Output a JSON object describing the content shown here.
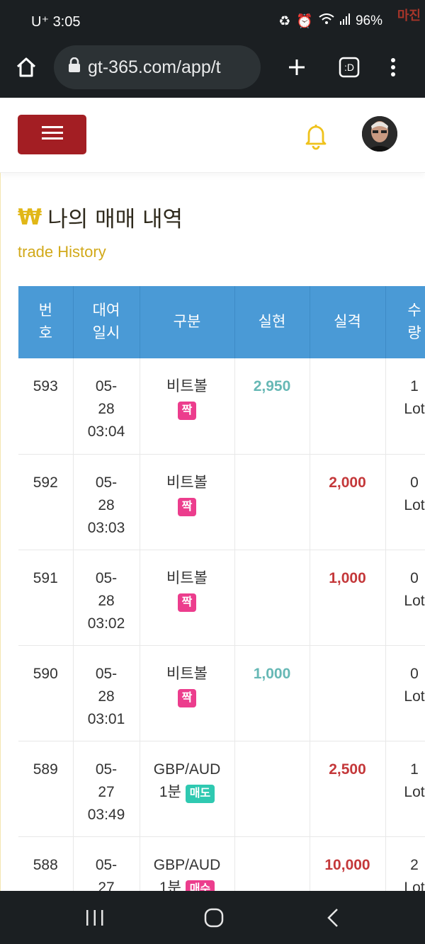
{
  "status": {
    "carrier": "U⁺",
    "time": "3:05",
    "battery": "96%",
    "watermark": "마진"
  },
  "browser": {
    "url": "gt-365.com/app/t",
    "tab_label": ":D"
  },
  "page": {
    "title_icon": "₩",
    "title": "나의 매매 내역",
    "subtitle": "trade History"
  },
  "table": {
    "headers": {
      "no": [
        "번",
        "호"
      ],
      "date": [
        "대여",
        "일시"
      ],
      "type": "구분",
      "real": "실현",
      "loss": "실격",
      "qty": [
        "수",
        "량"
      ]
    },
    "rows": [
      {
        "no": "593",
        "date_a": "05-",
        "date_b": "28",
        "time": "03:04",
        "game": "비트볼",
        "sub": "",
        "badge": "짝",
        "real": "2,950",
        "loss": "",
        "qty": "1",
        "unit": "Lot"
      },
      {
        "no": "592",
        "date_a": "05-",
        "date_b": "28",
        "time": "03:03",
        "game": "비트볼",
        "sub": "",
        "badge": "짝",
        "real": "",
        "loss": "2,000",
        "qty": "0",
        "unit": "Lot"
      },
      {
        "no": "591",
        "date_a": "05-",
        "date_b": "28",
        "time": "03:02",
        "game": "비트볼",
        "sub": "",
        "badge": "짝",
        "real": "",
        "loss": "1,000",
        "qty": "0",
        "unit": "Lot"
      },
      {
        "no": "590",
        "date_a": "05-",
        "date_b": "28",
        "time": "03:01",
        "game": "비트볼",
        "sub": "",
        "badge": "짝",
        "real": "1,000",
        "loss": "",
        "qty": "0",
        "unit": "Lot"
      },
      {
        "no": "589",
        "date_a": "05-",
        "date_b": "27",
        "time": "03:49",
        "game": "GBP/AUD",
        "sub": "1분",
        "badge": "매도",
        "real": "",
        "loss": "2,500",
        "qty": "1",
        "unit": "Lot"
      },
      {
        "no": "588",
        "date_a": "05-",
        "date_b": "27",
        "time": "",
        "game": "GBP/AUD",
        "sub": "1분",
        "badge": "매수",
        "real": "",
        "loss": "10,000",
        "qty": "2",
        "unit": "Lot"
      }
    ]
  },
  "colors": {
    "accent": "#a31e23",
    "gold": "#e1b717",
    "header_blue": "#4a9ad6",
    "profit": "#66b8b5",
    "loss": "#c4383a",
    "badge_pink": "#ec3d8d",
    "badge_teal": "#2fc9b1"
  },
  "icons": [
    "home-icon",
    "lock-icon",
    "plus-icon",
    "tabs-icon",
    "more-vert-icon",
    "menu-icon",
    "bell-icon",
    "avatar",
    "recents-icon",
    "home-circle-icon",
    "back-icon"
  ]
}
